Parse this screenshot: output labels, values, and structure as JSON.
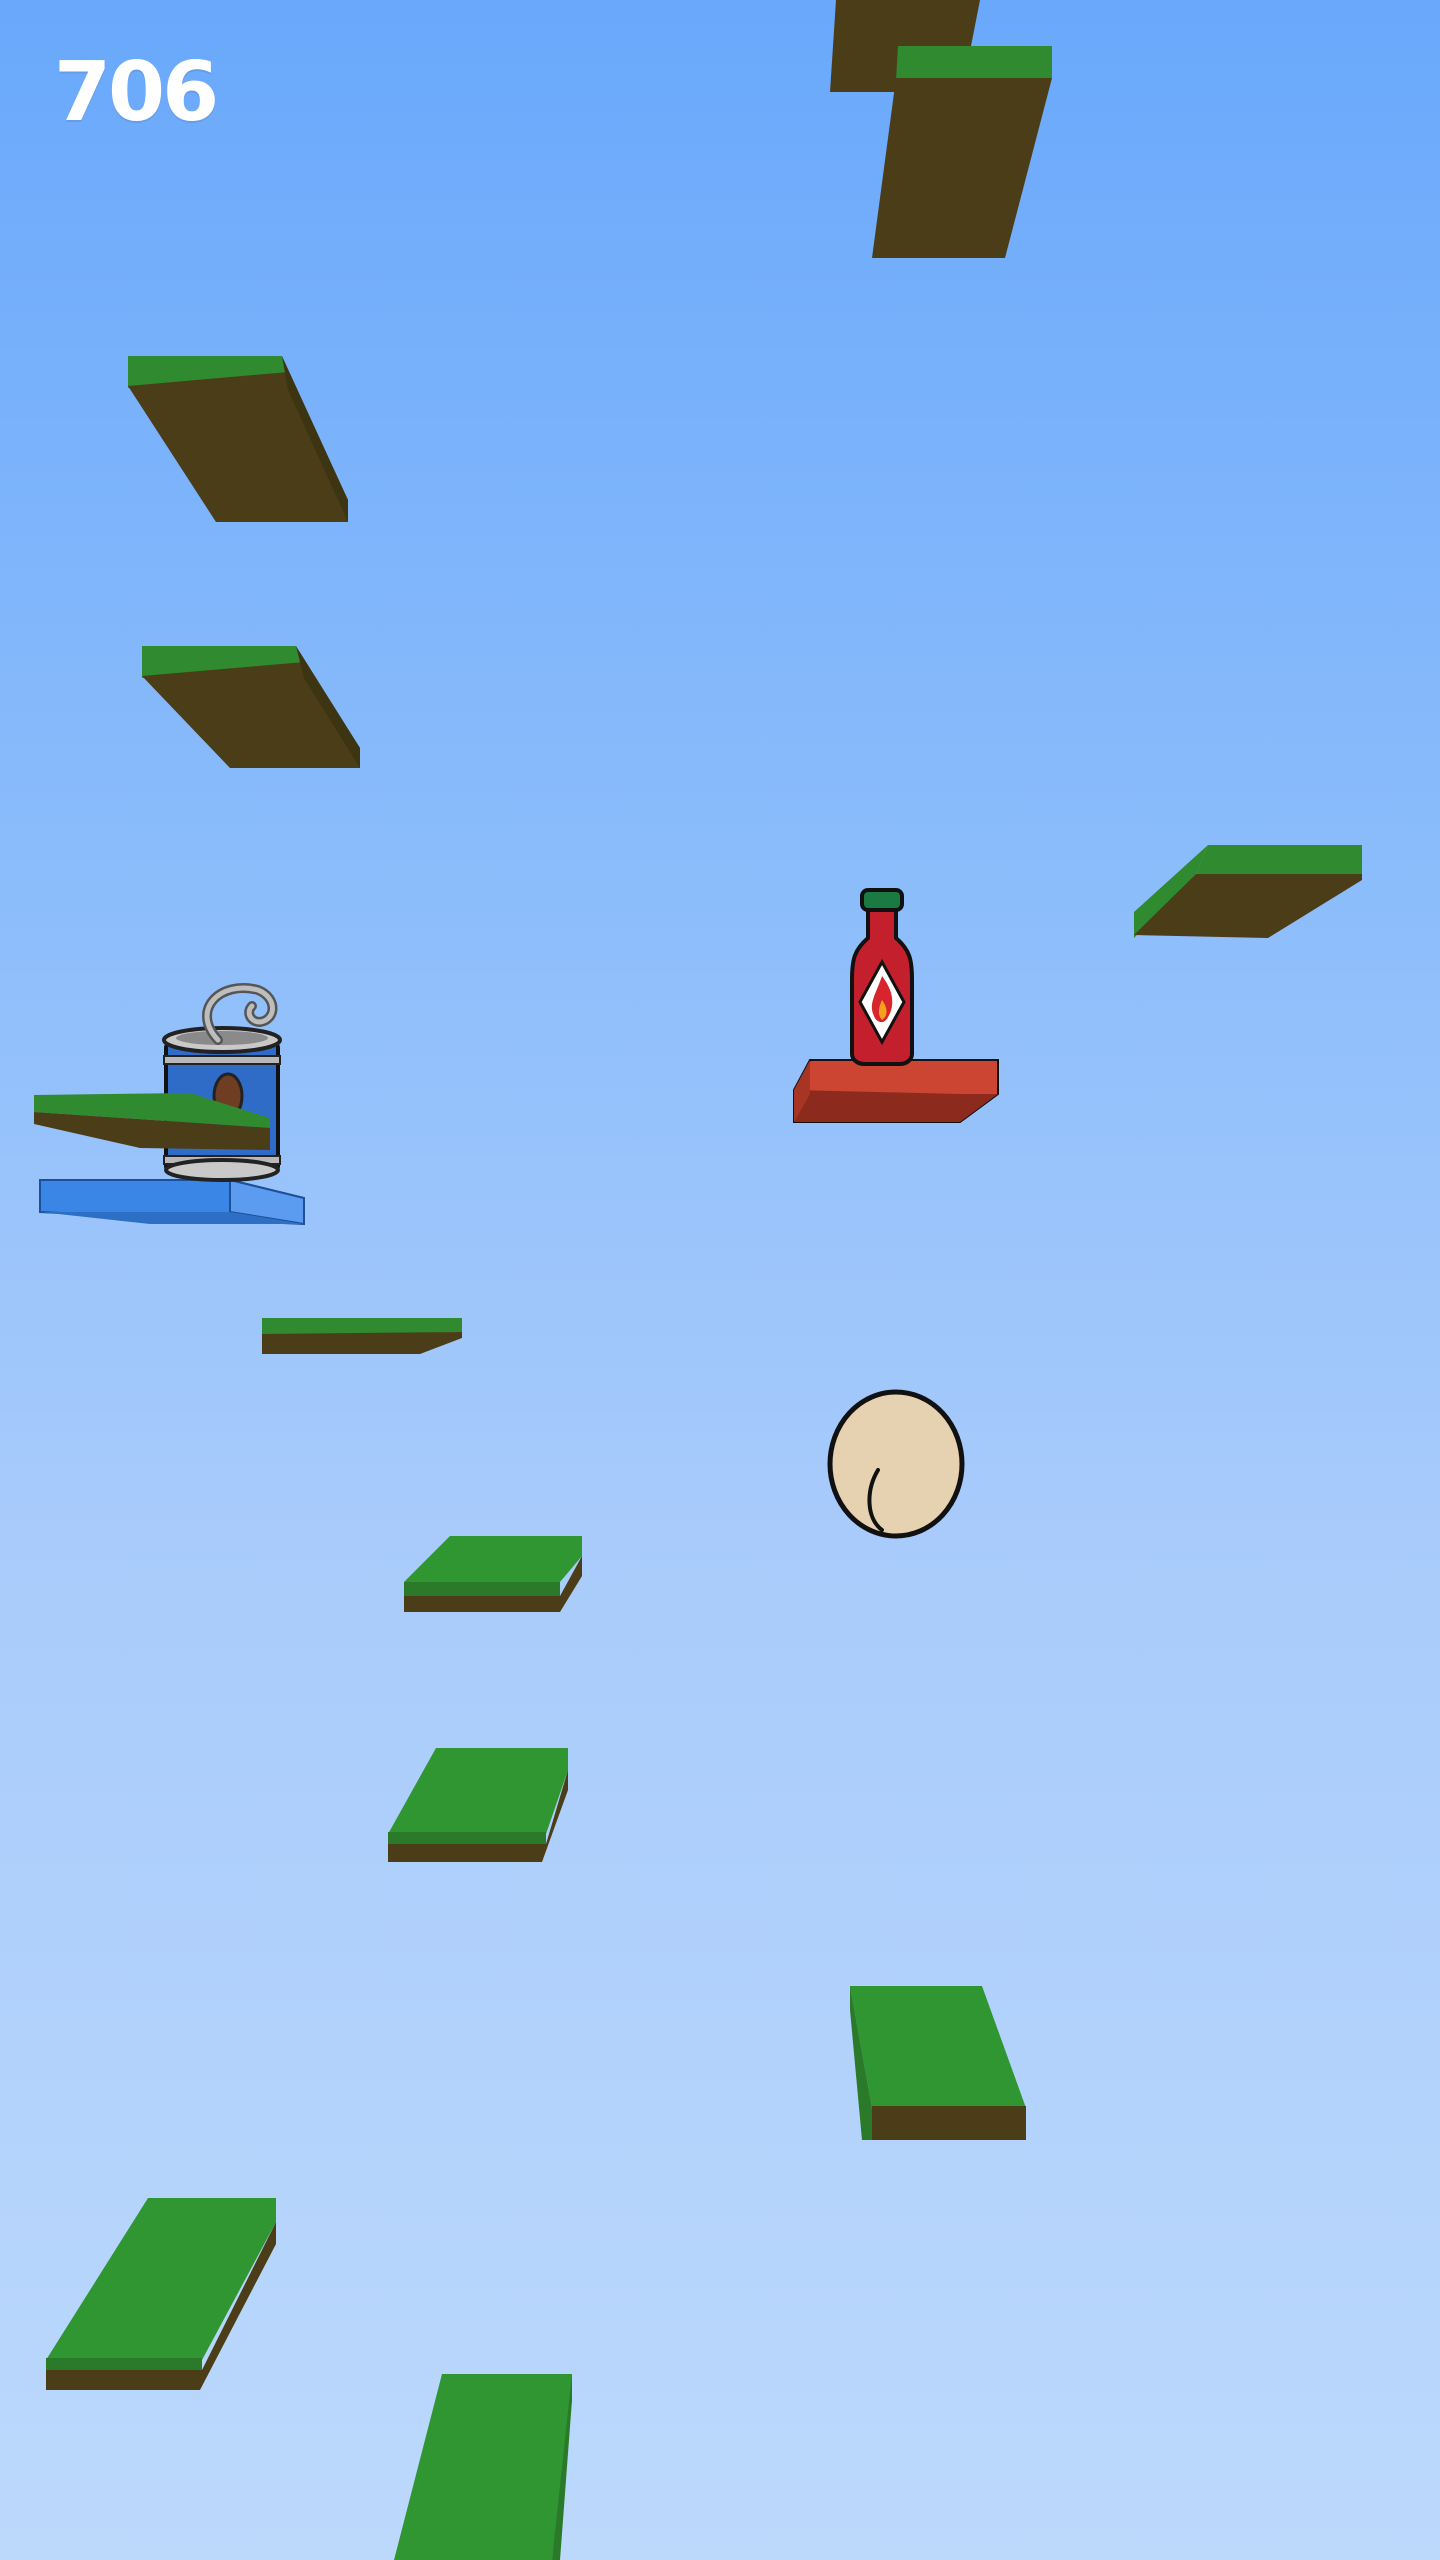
{
  "hud": {
    "score": "706"
  },
  "colors": {
    "sky_top": "#69a8fb",
    "sky_bottom": "#bcd9fc",
    "grass": "#2f9632",
    "dirt": "#4a3d17",
    "bounce_pad_blue": "#3a86e6",
    "hot_pad_red": "#cc4432"
  },
  "game": {
    "player": "egg-shaped-character",
    "powerups": [
      "hot-sauce-bottle",
      "can-of-beans"
    ]
  }
}
